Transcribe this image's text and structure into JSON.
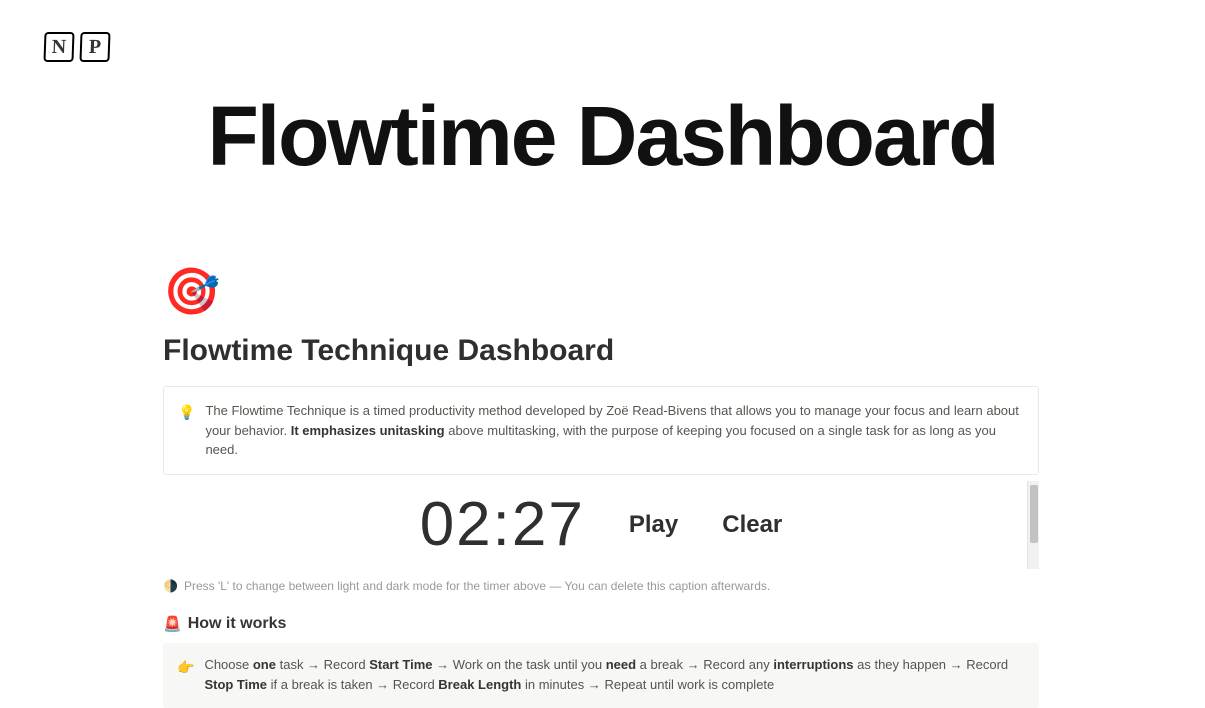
{
  "logo": {
    "letter1": "N",
    "letter2": "P"
  },
  "hero_title": "Flowtime Dashboard",
  "page_icon": "🎯",
  "page_title": "Flowtime Technique Dashboard",
  "intro_callout": {
    "emoji": "💡",
    "text_pre": "The Flowtime Technique is a timed productivity method developed by Zoë Read-Bivens that allows you to manage your focus and learn about your behavior. ",
    "bold_lead": "It emphasizes ",
    "bold_word": "unitasking",
    "text_post": " above multitasking, with the purpose of keeping you focused on a single task for as long as you need."
  },
  "timer": {
    "value": "02:27",
    "play_label": "Play",
    "clear_label": "Clear"
  },
  "caption": {
    "emoji": "🌗",
    "text": "Press 'L' to change between light and dark mode for the timer above — You can delete this caption afterwards."
  },
  "how_it_works": {
    "icon": "🚨",
    "heading": "How it works"
  },
  "steps": {
    "emoji": "👉",
    "p1": "Choose ",
    "b1": "one",
    "p2": " task → Record ",
    "b2": "Start Time",
    "p3": " → Work on the task until you ",
    "b3": "need",
    "p4": " a break → Record any ",
    "b4": "interruptions",
    "p5": " as they happen → Record ",
    "b5": "Stop Time",
    "p6": " if a break is taken → Record ",
    "b6": "Break Length",
    "p7": " in minutes → Repeat until work is complete"
  }
}
